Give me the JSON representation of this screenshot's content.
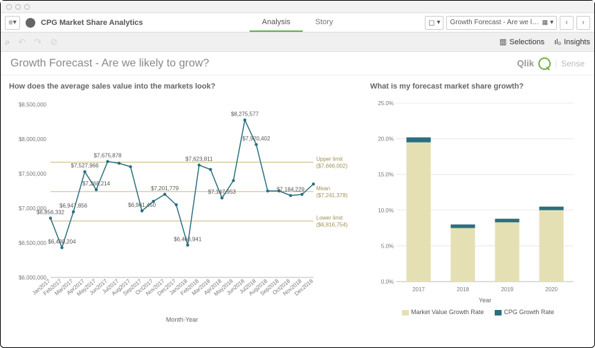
{
  "app_title": "CPG Market Share Analytics",
  "tabs": {
    "analysis": "Analysis",
    "story": "Story"
  },
  "toolbar": {
    "bookmark": "",
    "sheet_selector": "Growth Forecast - Are we lik…"
  },
  "selections_bar": {
    "selections": "Selections",
    "insights": "Insights"
  },
  "sheet_title": "Growth Forecast - Are we likely to grow?",
  "brand": {
    "qlik": "Qlik",
    "sense": "Sense"
  },
  "left_chart": {
    "title": "How does the average sales value into the markets look?",
    "x_axis_title": "Month-Year",
    "limits": {
      "upper_label": "Upper limit",
      "upper_value": "($7,666,002)",
      "mean_label": "Mean",
      "mean_value": "($7,241,378)",
      "lower_label": "Lower limit",
      "lower_value": "($6,816,754)"
    }
  },
  "right_chart": {
    "title": "What is my forecast market share growth?",
    "x_axis_title": "Year",
    "legend_market": "Market Value Growth Rate",
    "legend_cpg": "CPG Growth Rate"
  },
  "chart_data": [
    {
      "type": "line",
      "title": "How does the average sales value into the markets look?",
      "xlabel": "Month-Year",
      "ylabel": "",
      "ylim": [
        6000000,
        8500000
      ],
      "y_ticks": [
        "$6,000,000",
        "$6,500,000",
        "$7,000,000",
        "$7,500,000",
        "$8,000,000",
        "$8,500,000"
      ],
      "categories": [
        "Jan2017",
        "Feb2017",
        "Mar2017",
        "Apr2017",
        "May2017",
        "Jun2017",
        "Jul2017",
        "Aug2017",
        "Sep2017",
        "Oct2017",
        "Nov2017",
        "Dec2017",
        "Jan2018",
        "Feb2018",
        "Mar2018",
        "Apr2018",
        "May2018",
        "Jun2018",
        "Jul2018",
        "Aug2018",
        "Sep2018",
        "Oct2018",
        "Nov2018",
        "Dec2018"
      ],
      "values": [
        6856332,
        6430204,
        6947856,
        7527966,
        7268214,
        7675878,
        7650000,
        7600000,
        6961450,
        7100000,
        7201779,
        7050000,
        6466941,
        7623811,
        7560000,
        7147953,
        7400000,
        8275577,
        7920402,
        7250000,
        7250000,
        7184229,
        7200000,
        7350000
      ],
      "point_labels": {
        "Jan2017": "$6,856,332",
        "Feb2017": "$6,430,204",
        "Mar2017": "$6,947,856",
        "Apr2017": "$7,527,966",
        "May2017": "$7,268,214",
        "Jun2017": "$7,675,878",
        "Sep2017": "$6,961,450",
        "Nov2017": "$7,201,779",
        "Jan2018": "$6,466,941",
        "Feb2018": "$7,623,811",
        "Apr2018": "$7,147,953",
        "Jun2018": "$8,275,577",
        "Jul2018": "$7,920,402",
        "Oct2018": "$7,184,229"
      },
      "reference_lines": {
        "upper": 7666002,
        "mean": 7241378,
        "lower": 6816754
      }
    },
    {
      "type": "bar",
      "title": "What is my forecast market share growth?",
      "xlabel": "Year",
      "ylabel": "",
      "ylim": [
        0,
        25
      ],
      "y_ticks": [
        "0.0%",
        "5.0%",
        "10.0%",
        "15.0%",
        "20.0%",
        "25.0%"
      ],
      "categories": [
        "2017",
        "2018",
        "2019",
        "2020"
      ],
      "series": [
        {
          "name": "Market Value Growth Rate",
          "values": [
            19.5,
            7.5,
            8.3,
            10.0
          ]
        },
        {
          "name": "CPG Growth Rate",
          "values": [
            0.7,
            0.5,
            0.5,
            0.5
          ]
        }
      ],
      "stacked": true
    }
  ]
}
